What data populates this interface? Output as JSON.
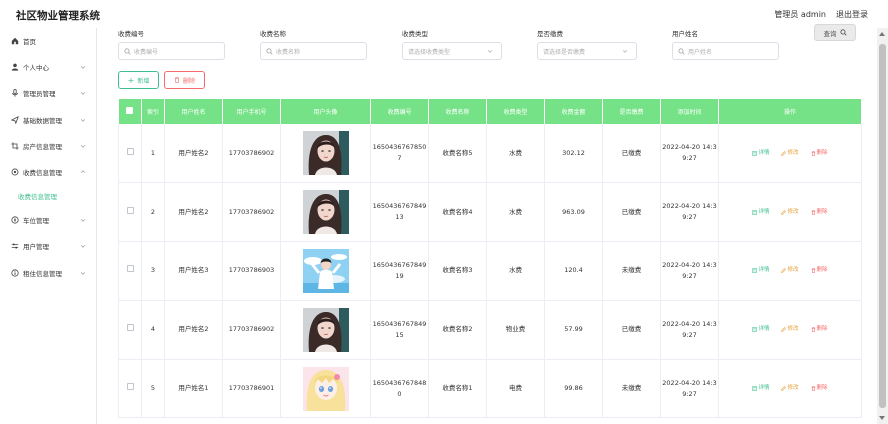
{
  "app": {
    "title": "社区物业管理系统",
    "admin_label": "管理员 admin",
    "logout_label": "退出登录"
  },
  "sidebar": {
    "items": [
      {
        "label": "首页",
        "icon": "home-icon",
        "chevron": false
      },
      {
        "label": "个人中心",
        "icon": "user-icon",
        "chevron": true
      },
      {
        "label": "管理员管理",
        "icon": "mic-icon",
        "chevron": true
      },
      {
        "label": "基础数据管理",
        "icon": "send-icon",
        "chevron": true
      },
      {
        "label": "房产信息管理",
        "icon": "crop-icon",
        "chevron": true
      },
      {
        "label": "收费信息管理",
        "icon": "settings-icon",
        "chevron": true,
        "expanded": true
      },
      {
        "label": "车位管理",
        "icon": "compass-icon",
        "chevron": true
      },
      {
        "label": "用户管理",
        "icon": "sliders-icon",
        "chevron": true
      },
      {
        "label": "租住信息管理",
        "icon": "info-icon",
        "chevron": true
      }
    ],
    "submenu": {
      "label": "收费信息管理"
    }
  },
  "filters": {
    "fee_no": {
      "label": "收费编号",
      "placeholder": "收费编号"
    },
    "fee_name": {
      "label": "收费名称",
      "placeholder": "收费名称"
    },
    "fee_type": {
      "label": "收费类型",
      "placeholder": "请选择收费类型"
    },
    "paid": {
      "label": "是否缴费",
      "placeholder": "请选择是否缴费"
    },
    "user_name": {
      "label": "用户姓名",
      "placeholder": "用户姓名"
    },
    "search_label": "查询"
  },
  "toolbar": {
    "add_label": "新增",
    "delete_label": "删除"
  },
  "table": {
    "headers": [
      "",
      "索引",
      "用户姓名",
      "用户手机号",
      "用户头像",
      "收费编号",
      "收费名称",
      "收费类型",
      "收费金额",
      "是否缴费",
      "添加时间",
      "操作"
    ],
    "actions": {
      "detail": "详情",
      "edit": "修改",
      "delete": "删除"
    },
    "rows": [
      {
        "index": "1",
        "name": "用户姓名2",
        "phone": "17703786902",
        "avatar": "girl",
        "fee_no": "16504367678507",
        "fee_name": "收费名称5",
        "fee_type": "水费",
        "amount": "302.12",
        "paid": "已缴费",
        "time": "2022-04-20 14:39:27"
      },
      {
        "index": "2",
        "name": "用户姓名2",
        "phone": "17703786902",
        "avatar": "girl",
        "fee_no": "165043676784913",
        "fee_name": "收费名称4",
        "fee_type": "水费",
        "amount": "963.09",
        "paid": "已缴费",
        "time": "2022-04-20 14:39:27"
      },
      {
        "index": "3",
        "name": "用户姓名3",
        "phone": "17703786903",
        "avatar": "boy",
        "fee_no": "165043676784919",
        "fee_name": "收费名称3",
        "fee_type": "水费",
        "amount": "120.4",
        "paid": "未缴费",
        "time": "2022-04-20 14:39:27"
      },
      {
        "index": "4",
        "name": "用户姓名2",
        "phone": "17703786902",
        "avatar": "girl",
        "fee_no": "165043676784915",
        "fee_name": "收费名称2",
        "fee_type": "物业费",
        "amount": "57.99",
        "paid": "已缴费",
        "time": "2022-04-20 14:39:27"
      },
      {
        "index": "5",
        "name": "用户姓名1",
        "phone": "17703786901",
        "avatar": "anime",
        "fee_no": "16504367678480",
        "fee_name": "收费名称1",
        "fee_type": "电费",
        "amount": "99.86",
        "paid": "未缴费",
        "time": "2022-04-20 14:39:27"
      }
    ]
  },
  "colors": {
    "accent": "#3fbf8f",
    "header_bg": "#76e287",
    "danger": "#f56c6c",
    "warning": "#e6a23c"
  }
}
